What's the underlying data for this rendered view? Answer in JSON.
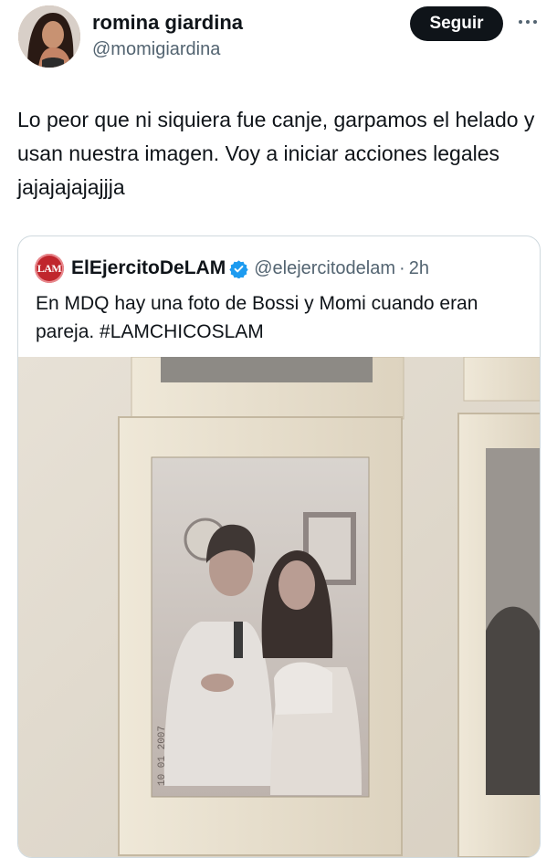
{
  "author": {
    "display_name": "romina giardina",
    "handle": "@momigiardina",
    "avatar_icon": "profile-photo"
  },
  "follow_button": {
    "label": "Seguir"
  },
  "more_menu": {
    "icon": "more-horizontal-icon"
  },
  "tweet": {
    "text": "Lo peor que ni siquiera fue canje, garpamos el helado y usan nuestra imagen. Voy a iniciar acciones legales jajajajajajjja"
  },
  "quoted_tweet": {
    "avatar_text": "LAM",
    "display_name": "ElEjercitoDeLAM",
    "verified": true,
    "verified_color": "#1d9bf0",
    "handle": "@elejercitodelam",
    "separator": "·",
    "time": "2h",
    "text": "En MDQ hay una foto de Bossi y Momi cuando eran pareja. #LAMCHICOSLAM",
    "media": {
      "photo_date_stamp": "10 01 2007"
    }
  },
  "colors": {
    "text_primary": "#0f1419",
    "text_secondary": "#536471",
    "border": "#cfd9de",
    "button_bg": "#0f1419",
    "lam_red": "#c0262d"
  }
}
